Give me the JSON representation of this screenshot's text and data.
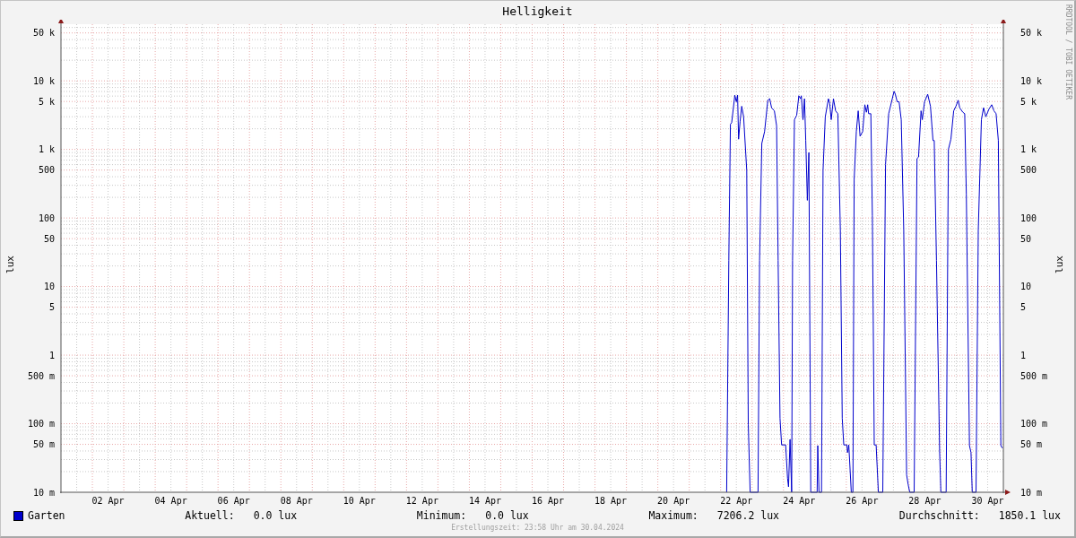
{
  "title": "Helligkeit",
  "chart": {
    "ylabel": "lux",
    "yticks": [
      "50 k",
      "10 k",
      "5 k",
      "1 k",
      "500",
      "100",
      "50",
      "10",
      "5",
      "1",
      "500 m",
      "100 m",
      "50 m",
      "10 m"
    ],
    "xticks": [
      "02 Apr",
      "04 Apr",
      "06 Apr",
      "08 Apr",
      "10 Apr",
      "12 Apr",
      "14 Apr",
      "16 Apr",
      "18 Apr",
      "20 Apr",
      "22 Apr",
      "24 Apr",
      "26 Apr",
      "28 Apr",
      "30 Apr"
    ],
    "series": {
      "name": "Garten",
      "color": "#0000cc"
    }
  },
  "right_axis": {
    "label": "lux",
    "ticks": [
      "50 k",
      "10 k",
      "5 k",
      "1 k",
      "500",
      "100",
      "50",
      "10",
      "5",
      "1",
      "500 m",
      "100 m",
      "50 m",
      "10 m"
    ]
  },
  "branding": "RRDTOOL / TOBI OETIKER",
  "legend": {
    "stats": [
      {
        "label": "Aktuell:",
        "value": "0.0 lux"
      },
      {
        "label": "Minimum:",
        "value": "0.0 lux"
      },
      {
        "label": "Maximum:",
        "value": "7206.2 lux"
      },
      {
        "label": "Durchschnitt:",
        "value": "1850.1 lux"
      }
    ]
  },
  "footer": "Erstellungszeit: 23:58 Uhr am 30.04.2024"
}
